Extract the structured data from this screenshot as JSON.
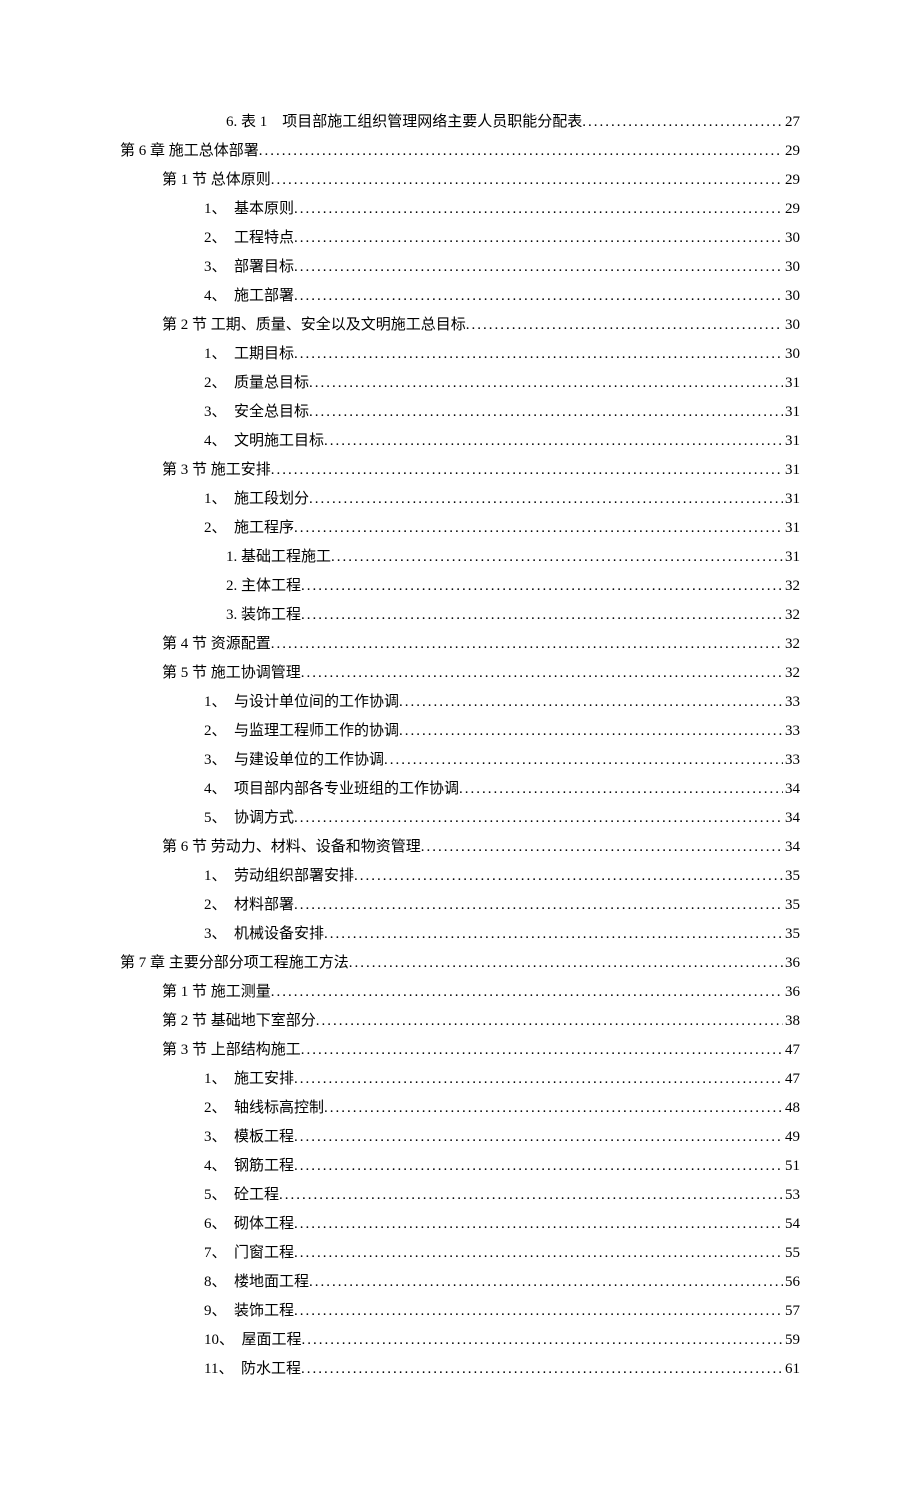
{
  "toc": [
    {
      "indent": 3,
      "label": "6. 表 1　项目部施工组织管理网络主要人员职能分配表",
      "page": "27"
    },
    {
      "indent": 0,
      "label": "第 6 章  施工总体部署",
      "page": "29"
    },
    {
      "indent": 1,
      "label": "第 1 节  总体原则",
      "page": "29"
    },
    {
      "indent": 2,
      "label": "1、　基本原则",
      "page": "29"
    },
    {
      "indent": 2,
      "label": "2、　工程特点",
      "page": "30"
    },
    {
      "indent": 2,
      "label": "3、　部署目标",
      "page": "30"
    },
    {
      "indent": 2,
      "label": "4、　施工部署",
      "page": "30"
    },
    {
      "indent": 1,
      "label": "第 2 节  工期、质量、安全以及文明施工总目标",
      "page": "30"
    },
    {
      "indent": 2,
      "label": "1、　工期目标",
      "page": "30"
    },
    {
      "indent": 2,
      "label": "2、　质量总目标",
      "page": "31"
    },
    {
      "indent": 2,
      "label": "3、　安全总目标",
      "page": "31"
    },
    {
      "indent": 2,
      "label": "4、　文明施工目标",
      "page": "31"
    },
    {
      "indent": 1,
      "label": "第 3 节  施工安排",
      "page": "31"
    },
    {
      "indent": 2,
      "label": "1、　施工段划分",
      "page": "31"
    },
    {
      "indent": 2,
      "label": "2、　施工程序",
      "page": "31"
    },
    {
      "indent": 4,
      "label": "1. 基础工程施工",
      "page": "31"
    },
    {
      "indent": 4,
      "label": "2. 主体工程",
      "page": "32"
    },
    {
      "indent": 4,
      "label": "3. 装饰工程",
      "page": "32"
    },
    {
      "indent": 1,
      "label": "第 4 节  资源配置",
      "page": "32"
    },
    {
      "indent": 1,
      "label": "第 5 节  施工协调管理",
      "page": "32"
    },
    {
      "indent": 2,
      "label": "1、　与设计单位间的工作协调",
      "page": "33"
    },
    {
      "indent": 2,
      "label": "2、　与监理工程师工作的协调",
      "page": "33"
    },
    {
      "indent": 2,
      "label": "3、　与建设单位的工作协调",
      "page": "33"
    },
    {
      "indent": 2,
      "label": "4、　项目部内部各专业班组的工作协调",
      "page": "34"
    },
    {
      "indent": 2,
      "label": "5、　协调方式",
      "page": "34"
    },
    {
      "indent": 1,
      "label": "第 6 节  劳动力、材料、设备和物资管理",
      "page": "34"
    },
    {
      "indent": 2,
      "label": "1、　劳动组织部署安排",
      "page": "35"
    },
    {
      "indent": 2,
      "label": "2、　材料部署",
      "page": "35"
    },
    {
      "indent": 2,
      "label": "3、　机械设备安排",
      "page": "35"
    },
    {
      "indent": 0,
      "label": "第 7 章  主要分部分项工程施工方法",
      "page": "36"
    },
    {
      "indent": 1,
      "label": "第 1 节  施工测量",
      "page": "36"
    },
    {
      "indent": 1,
      "label": "第 2 节  基础地下室部分",
      "page": "38"
    },
    {
      "indent": 1,
      "label": "第 3 节  上部结构施工",
      "page": "47"
    },
    {
      "indent": 2,
      "label": "1、　施工安排",
      "page": "47"
    },
    {
      "indent": 2,
      "label": "2、　轴线标高控制",
      "page": "48"
    },
    {
      "indent": 2,
      "label": "3、　模板工程",
      "page": "49"
    },
    {
      "indent": 2,
      "label": "4、　钢筋工程",
      "page": "51"
    },
    {
      "indent": 2,
      "label": "5、　砼工程",
      "page": "53"
    },
    {
      "indent": 2,
      "label": "6、　砌体工程",
      "page": "54"
    },
    {
      "indent": 2,
      "label": "7、　门窗工程",
      "page": "55"
    },
    {
      "indent": 2,
      "label": "8、　楼地面工程",
      "page": "56"
    },
    {
      "indent": 2,
      "label": "9、　装饰工程",
      "page": "57"
    },
    {
      "indent": 2,
      "label": "10、　屋面工程",
      "page": "59"
    },
    {
      "indent": 2,
      "label": "11、　防水工程",
      "page": "61"
    }
  ]
}
